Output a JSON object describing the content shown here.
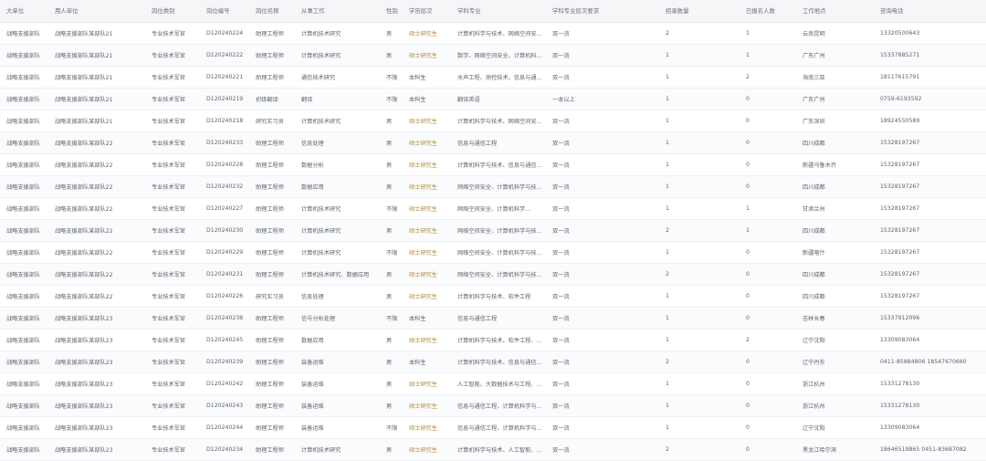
{
  "columns": [
    "大单位",
    "用人单位",
    "岗位类别",
    "岗位编号",
    "岗位名称",
    "从事工作",
    "性别",
    "学历层次",
    "学科专业",
    "学科专业层次要求",
    "招录数量",
    "已报名人数",
    "工作地点",
    "咨询电话"
  ],
  "rows": [
    [
      "战略支援部队",
      "战略支援部队某部队21",
      "专业技术军官",
      "D120240224",
      "助理工程师",
      "计算机技术研究",
      "男",
      "硕士研究生",
      "计算机科学与技术、网络空间安全…",
      "双一流",
      "2",
      "1",
      "云南昆明",
      "13320500643"
    ],
    [
      "战略支援部队",
      "战略支援部队某部队21",
      "专业技术军官",
      "D120240222",
      "助理工程师",
      "计算机技术研究",
      "男",
      "硕士研究生",
      "数学、网络空间安全、计算机科学…",
      "双一流",
      "1",
      "1",
      "广东广州",
      "15337885271"
    ],
    [
      "战略支援部队",
      "战略支援部队某部队21",
      "专业技术军官",
      "D120240221",
      "助理工程师",
      "通信技术研究",
      "不限",
      "本科生",
      "水声工程、测控技术、信息与通信…",
      "双一流",
      "1",
      "2",
      "海南三亚",
      "18117615791"
    ],
    [
      "战略支援部队",
      "战略支援部队某部队21",
      "专业技术军官",
      "D120240219",
      "初级翻译",
      "翻译",
      "不限",
      "本科生",
      "翻译英语",
      "一本以上",
      "1",
      "0",
      "广东广州",
      "0759-6193592"
    ],
    [
      "战略支援部队",
      "战略支援部队某部队21",
      "专业技术军官",
      "D120240218",
      "研究实习员",
      "计算机技术研究",
      "男",
      "硕士研究生",
      "计算机科学与技术、网络空间安全…",
      "双一流",
      "1",
      "0",
      "广东深圳",
      "18924550589"
    ],
    [
      "战略支援部队",
      "战略支援部队某部队22",
      "专业技术军官",
      "D120240233",
      "助理工程师",
      "信息处理",
      "男",
      "硕士研究生",
      "信息与通信工程",
      "双一流",
      "1",
      "0",
      "四川成都",
      "15328197267"
    ],
    [
      "战略支援部队",
      "战略支援部队某部队22",
      "专业技术军官",
      "D120240228",
      "助理工程师",
      "数据分析",
      "男",
      "硕士研究生",
      "计算机科学与技术、信息与通信工…",
      "双一流",
      "1",
      "0",
      "新疆乌鲁木齐",
      "15328197267"
    ],
    [
      "战略支援部队",
      "战略支援部队某部队22",
      "专业技术军官",
      "D120240232",
      "助理工程师",
      "数据应用",
      "男",
      "硕士研究生",
      "网络空间安全、计算机科学与技术…",
      "双一流",
      "1",
      "0",
      "四川成都",
      "15328197267"
    ],
    [
      "战略支援部队",
      "战略支援部队某部队22",
      "专业技术军官",
      "D120240227",
      "助理工程师",
      "计算机技术研究",
      "不限",
      "硕士研究生",
      "网络空间安全、计算机科学…",
      "双一流",
      "1",
      "1",
      "甘肃兰州",
      "15328197267"
    ],
    [
      "战略支援部队",
      "战略支援部队某部队22",
      "专业技术军官",
      "D120240230",
      "助理工程师",
      "计算机技术研究",
      "男",
      "硕士研究生",
      "网络空间安全、计算机科学与技术…",
      "双一流",
      "2",
      "1",
      "四川成都",
      "15328197267"
    ],
    [
      "战略支援部队",
      "战略支援部队某部队22",
      "专业技术军官",
      "D120240229",
      "助理工程师",
      "计算机技术研究",
      "不限",
      "硕士研究生",
      "网络空间安全、计算机科学与技术…",
      "双一流",
      "1",
      "0",
      "新疆喀什",
      "15328197267"
    ],
    [
      "战略支援部队",
      "战略支援部队某部队22",
      "专业技术军官",
      "D120240231",
      "助理工程师",
      "计算机技术研究、数据应用",
      "男",
      "硕士研究生",
      "网络空间安全、计算机科学与技术…",
      "双一流",
      "2",
      "0",
      "四川成都",
      "15328197267"
    ],
    [
      "战略支援部队",
      "战略支援部队某部队22",
      "专业技术军官",
      "D120240226",
      "研究实习员",
      "信息处理",
      "男",
      "硕士研究生",
      "计算机科学与技术、软件工程",
      "双一流",
      "1",
      "0",
      "四川成都",
      "15328197267"
    ],
    [
      "战略支援部队",
      "战略支援部队某部队23",
      "专业技术军官",
      "D120240238",
      "助理工程师",
      "信号分析处理",
      "不限",
      "本科生",
      "信息与通信工程",
      "双一流",
      "1",
      "0",
      "吉林长春",
      "15337912096"
    ],
    [
      "战略支援部队",
      "战略支援部队某部队23",
      "专业技术军官",
      "D120240245",
      "助理工程师",
      "数据应用",
      "男",
      "硕士研究生",
      "计算机科学与技术、软件工程、控…",
      "双一流",
      "1",
      "2",
      "辽宁沈阳",
      "13309083064"
    ],
    [
      "战略支援部队",
      "战略支援部队某部队23",
      "专业技术军官",
      "D120240239",
      "助理工程师",
      "装备运维",
      "男",
      "本科生",
      "计算机科学与技术、信息与通信工程",
      "双一流",
      "2",
      "0",
      "辽宁丹东",
      "0411-85884806 18547670660"
    ],
    [
      "战略支援部队",
      "战略支援部队某部队23",
      "专业技术军官",
      "D120240242",
      "助理工程师",
      "装备运维",
      "男",
      "硕士研究生",
      "人工智能、大数据技术与工程、计…",
      "双一流",
      "1",
      "0",
      "浙江杭州",
      "15331278130"
    ],
    [
      "战略支援部队",
      "战略支援部队某部队23",
      "专业技术军官",
      "D120240243",
      "助理工程师",
      "装备运维",
      "男",
      "硕士研究生",
      "信息与通信工程、计算机科学与技术",
      "双一流",
      "1",
      "0",
      "浙江杭州",
      "15331278130"
    ],
    [
      "战略支援部队",
      "战略支援部队某部队23",
      "专业技术军官",
      "D120240244",
      "助理工程师",
      "装备运维",
      "不限",
      "硕士研究生",
      "信息与通信工程、计算机科学与技…",
      "双一流",
      "1",
      "0",
      "辽宁沈阳",
      "13309083064"
    ],
    [
      "战略支援部队",
      "战略支援部队某部队23",
      "专业技术军官",
      "D120240234",
      "助理工程师",
      "计算机技术研究",
      "男",
      "硕士研究生",
      "计算机科学与技术、人工智能、软…",
      "双一流",
      "2",
      "0",
      "黑龙江哈尔滨",
      "18646519865 0451-83687082"
    ]
  ],
  "colors": {
    "gold": "#b58a3a"
  }
}
